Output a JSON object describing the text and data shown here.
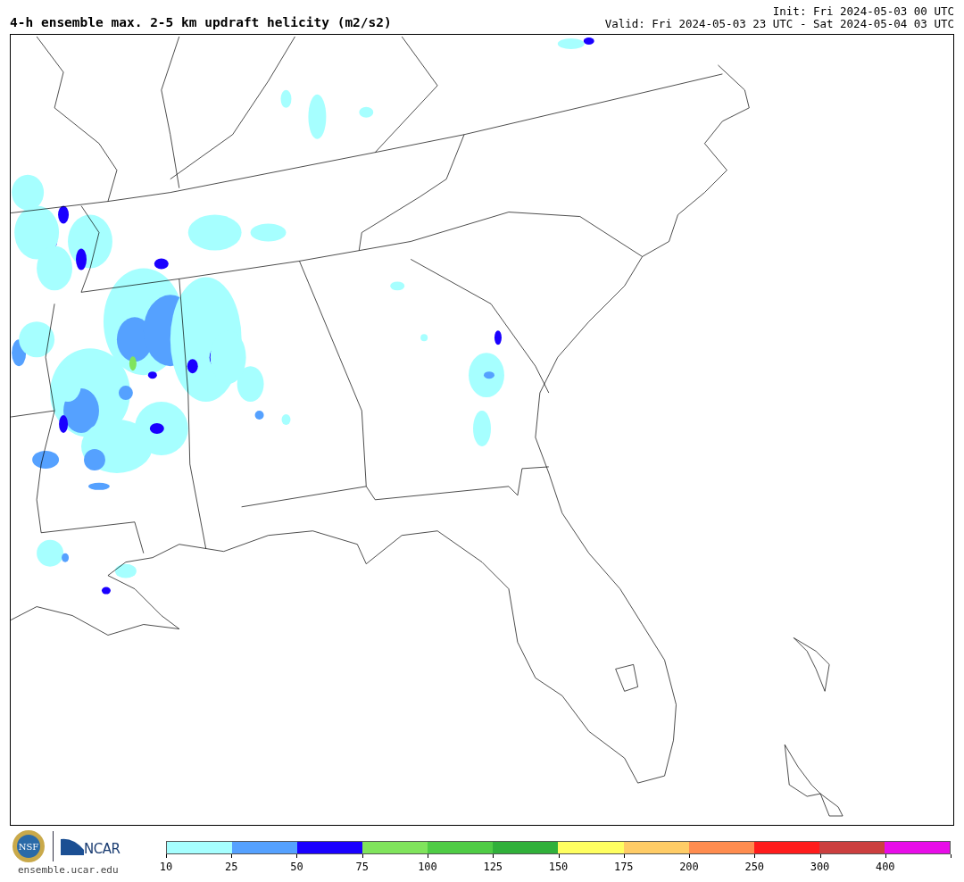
{
  "title": "4-h ensemble max. 2-5 km updraft helicity (m2/s2)",
  "init": "Init: Fri 2024-05-03 00 UTC",
  "valid": "Valid: Fri 2024-05-03 23 UTC - Sat 2024-05-04 03 UTC",
  "logos": {
    "nsf": "NSF",
    "ncar": "NCAR",
    "site": "ensemble.ucar.edu"
  },
  "colorbar": [
    {
      "label": "10",
      "color": "#a6ffff"
    },
    {
      "label": "25",
      "color": "#55a1ff"
    },
    {
      "label": "50",
      "color": "#1a00ff"
    },
    {
      "label": "75",
      "color": "#80e45c"
    },
    {
      "label": "100",
      "color": "#4fcc45"
    },
    {
      "label": "125",
      "color": "#30b03a"
    },
    {
      "label": "150",
      "color": "#ffff60"
    },
    {
      "label": "175",
      "color": "#ffcc66"
    },
    {
      "label": "200",
      "color": "#ff8c4f"
    },
    {
      "label": "250",
      "color": "#ff1c1c"
    },
    {
      "label": "300",
      "color": "#cc3f3f"
    },
    {
      "label": "400",
      "color": "#e80ce8"
    }
  ]
}
